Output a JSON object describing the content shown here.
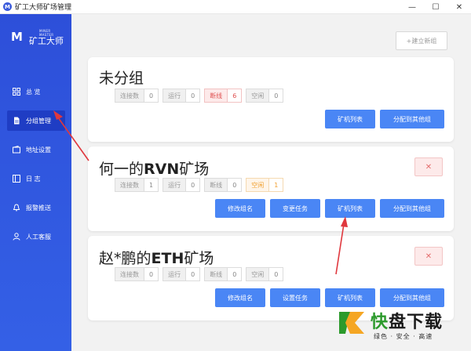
{
  "window": {
    "title": "矿工大师矿场管理",
    "app_icon": "M",
    "controls": [
      "—",
      "☐",
      "✕"
    ]
  },
  "sidebar": {
    "logo_mark": "M",
    "logo_sub": "MINER MASTER",
    "logo_cn": "矿工大师",
    "items": [
      {
        "label": "总 览",
        "icon": "grid-icon"
      },
      {
        "label": "分组管理",
        "icon": "document-icon",
        "active": true
      },
      {
        "label": "地址设置",
        "icon": "wallet-icon"
      },
      {
        "label": "日 志",
        "icon": "log-icon"
      },
      {
        "label": "报警推送",
        "icon": "bell-icon"
      },
      {
        "label": "人工客服",
        "icon": "user-icon"
      }
    ]
  },
  "main": {
    "new_group_label": "+建立新组",
    "groups": [
      {
        "name": "未分组",
        "stats": [
          {
            "label": "连接数",
            "value": "0"
          },
          {
            "label": "运行",
            "value": "0"
          },
          {
            "label": "断线",
            "value": "6",
            "status": "red"
          },
          {
            "label": "空闲",
            "value": "0"
          }
        ],
        "buttons": [
          "矿机列表",
          "分配到其他组"
        ]
      },
      {
        "name_prefix": "何一的",
        "name_bold": "RVN",
        "name_suffix": "矿场",
        "delete_label": "✕",
        "stats": [
          {
            "label": "连接数",
            "value": "1"
          },
          {
            "label": "运行",
            "value": "0"
          },
          {
            "label": "断线",
            "value": "0"
          },
          {
            "label": "空闲",
            "value": "1",
            "status": "orange"
          }
        ],
        "buttons": [
          "修改组名",
          "变更任务",
          "矿机列表",
          "分配到其他组"
        ]
      },
      {
        "name_prefix": "赵*鹏的",
        "name_bold": "ETH",
        "name_suffix": "矿场",
        "delete_label": "✕",
        "stats": [
          {
            "label": "连接数",
            "value": "0"
          },
          {
            "label": "运行",
            "value": "0"
          },
          {
            "label": "断线",
            "value": "0"
          },
          {
            "label": "空闲",
            "value": "0"
          }
        ],
        "buttons": [
          "修改组名",
          "设置任务",
          "矿机列表",
          "分配到其他组"
        ]
      }
    ]
  },
  "watermark": {
    "main_green": "快",
    "main_rest": "盘下载",
    "sub": "绿色 · 安全 · 高速"
  },
  "colors": {
    "sidebar": "#2d4fd9",
    "button": "#4a86f5",
    "danger": "#e05353",
    "warning": "#f0a030",
    "arrow": "#e0383e"
  }
}
